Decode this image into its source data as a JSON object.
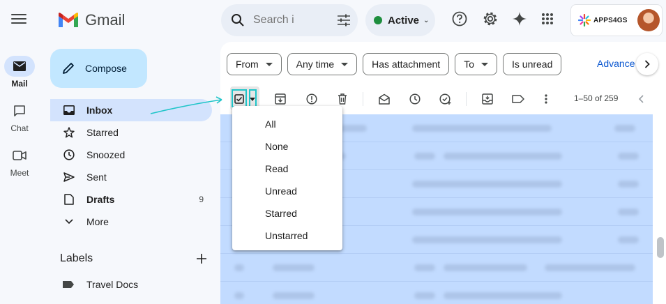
{
  "app": {
    "name": "Gmail"
  },
  "rail": {
    "items": [
      {
        "label": "Mail",
        "icon": "mail-icon",
        "active": true
      },
      {
        "label": "Chat",
        "icon": "chat-icon",
        "active": false
      },
      {
        "label": "Meet",
        "icon": "video-icon",
        "active": false
      }
    ]
  },
  "compose": {
    "label": "Compose"
  },
  "nav": {
    "items": [
      {
        "label": "Inbox",
        "icon": "inbox-icon",
        "count": ""
      },
      {
        "label": "Starred",
        "icon": "star-icon",
        "count": ""
      },
      {
        "label": "Snoozed",
        "icon": "clock-icon",
        "count": ""
      },
      {
        "label": "Sent",
        "icon": "send-icon",
        "count": ""
      },
      {
        "label": "Drafts",
        "icon": "draft-icon",
        "count": "9"
      },
      {
        "label": "More",
        "icon": "chevron-down-icon",
        "count": ""
      }
    ]
  },
  "labels": {
    "title": "Labels",
    "items": [
      {
        "label": "Travel Docs"
      }
    ]
  },
  "search": {
    "placeholder": "Search i"
  },
  "status": {
    "label": "Active",
    "color": "#1e8e3e"
  },
  "account": {
    "brand": "APPS4GS"
  },
  "filters": {
    "chips": [
      {
        "label": "From",
        "dropdown": true
      },
      {
        "label": "Any time",
        "dropdown": true
      },
      {
        "label": "Has attachment",
        "dropdown": false
      },
      {
        "label": "To",
        "dropdown": true
      },
      {
        "label": "Is unread",
        "dropdown": false
      }
    ],
    "advanced": "Advance"
  },
  "toolbar": {
    "pager": "1–50 of 259"
  },
  "select_menu": {
    "items": [
      "All",
      "None",
      "Read",
      "Unread",
      "Starred",
      "Unstarred"
    ]
  },
  "colors": {
    "accent": "#0b57d0",
    "selected_row": "#c2dbff",
    "highlight": "#20c5c9"
  }
}
